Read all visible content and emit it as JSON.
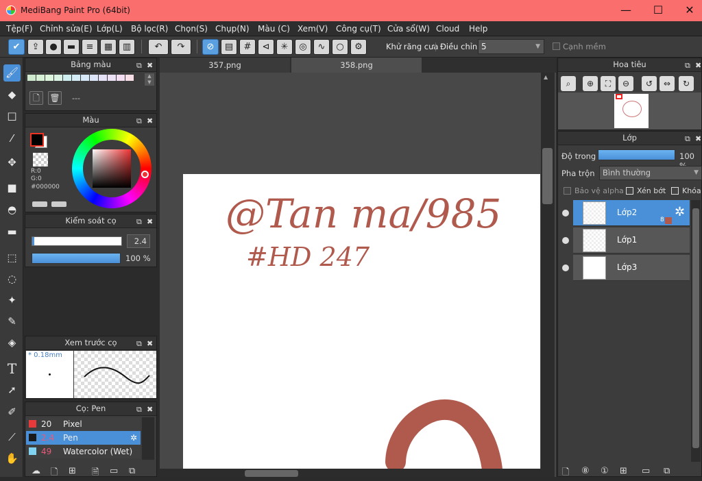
{
  "window": {
    "title": "MediBang Paint Pro (64bit)",
    "minimize": "—",
    "maximize": "☐",
    "close": "✕"
  },
  "menu": [
    "Tệp(F)",
    "Chỉnh sửa(E)",
    "Lớp(L)",
    "Bộ lọc(R)",
    "Chọn(S)",
    "Chụp(N)",
    "Màu (C)",
    "Xem(V)",
    "Công cụ(T)",
    "Cửa sổ(W)",
    "Cloud",
    "Help"
  ],
  "toolbar": {
    "antialias_label": "Khử răng cưa",
    "antialias_checked": true,
    "correction_label": "Điều chỉnh",
    "correction_value": "5",
    "soft_edge_label": "Cạnh mềm",
    "soft_edge_checked": false
  },
  "tabs": [
    "357.png",
    "358.png"
  ],
  "panels": {
    "palette": {
      "title": "Bảng màu",
      "name": "---"
    },
    "color": {
      "title": "Màu",
      "r": "R:0",
      "g": "G:0",
      "hex": "#000000"
    },
    "brush_control": {
      "title": "Kiểm soát cọ",
      "size": "2.4",
      "opacity": "100 %"
    },
    "brush_preview": {
      "title": "Xem trước cọ",
      "size_label": "* 0.18mm"
    },
    "brushes": {
      "title": "Cọ: Pen",
      "items": [
        {
          "size": "20",
          "name": "Pixel",
          "color": "#e83a3a"
        },
        {
          "size": "2.4",
          "name": "Pen",
          "color": "#1a1a1a"
        },
        {
          "size": "49",
          "name": "Watercolor (Wet)",
          "color": "#7fd3f0"
        }
      ]
    },
    "navigator": {
      "title": "Hoa tiêu"
    },
    "layers": {
      "title": "Lớp",
      "opacity_label": "Độ trong",
      "opacity_value": "100 %",
      "blend_label": "Pha trộn",
      "blend_value": "Bình thường",
      "protect_alpha": "Bảo vệ alpha",
      "clipping": "Xén bớt",
      "lock": "Khóa",
      "items": [
        {
          "name": "Lớp2",
          "badge": "8"
        },
        {
          "name": "Lớp1"
        },
        {
          "name": "Lớp3"
        }
      ]
    }
  },
  "canvas": {
    "handwriting_line1": "@Tan ma/985",
    "handwriting_line2": "#HD 247",
    "ink_color": "#b05a4e"
  }
}
